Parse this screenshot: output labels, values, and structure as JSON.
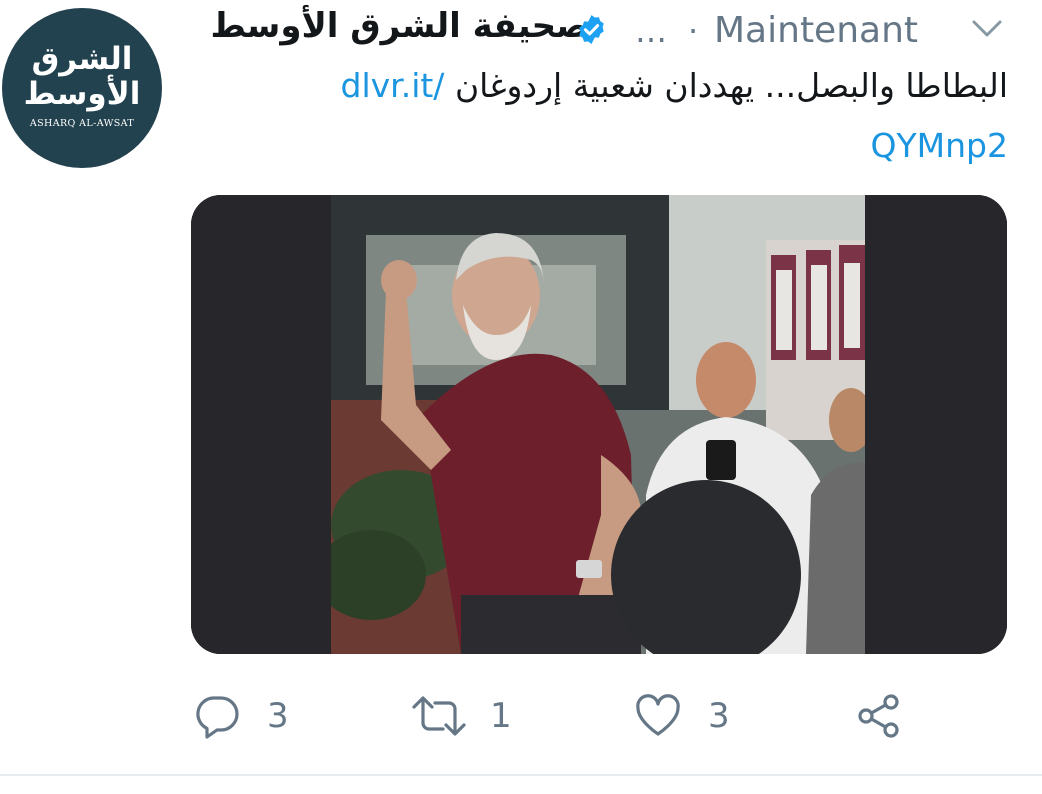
{
  "account": {
    "display_name": "صحيفة الشرق الأوسط",
    "truncation": "…",
    "separator": "·",
    "timestamp": "Maintenant",
    "verified": true,
    "avatar_logo": {
      "arabic_line1": "الشرق",
      "arabic_line2": "الأوسط",
      "english": "ASHARQ AL-AWSAT"
    }
  },
  "tweet": {
    "text_line1": "البطاطا والبصل... يهددان شعبية إردوغان",
    "link_part1": "dlvr.it/",
    "link_part2": "QYMnp2"
  },
  "actions": {
    "reply_count": "3",
    "retweet_count": "1",
    "like_count": "3"
  },
  "icons": {
    "verified": "verified-badge-icon",
    "caret": "chevron-down-icon",
    "reply": "reply-icon",
    "retweet": "retweet-icon",
    "like": "heart-icon",
    "share": "share-icon"
  },
  "colors": {
    "text": "#14171a",
    "secondary": "#657786",
    "link": "#1b95e0",
    "verified": "#1da1f2",
    "avatar_bg": "#23424f"
  }
}
